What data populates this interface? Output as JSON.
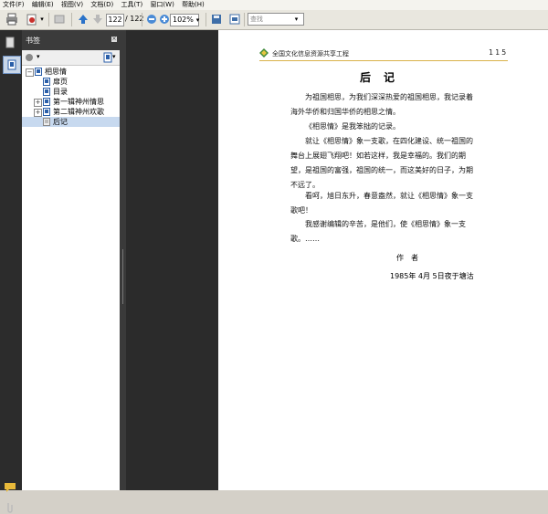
{
  "menu": {
    "items": [
      "文件(F)",
      "编辑(E)",
      "视图(V)",
      "文档(D)",
      "工具(T)",
      "窗口(W)",
      "帮助(H)"
    ]
  },
  "toolbar": {
    "page_current": "122",
    "page_total": "/ 122",
    "zoom": "102%",
    "search_placeholder": "查找"
  },
  "sidebar": {
    "title": "书签",
    "items": [
      {
        "label": "相思情",
        "level": 0,
        "expander": "−"
      },
      {
        "label": "扉页",
        "level": 1
      },
      {
        "label": "目录",
        "level": 1
      },
      {
        "label": "第一辑神州情思",
        "level": 1,
        "expander": "+"
      },
      {
        "label": "第二辑神州欢歌",
        "level": 1,
        "expander": "+"
      },
      {
        "label": "后记",
        "level": 1,
        "selected": true
      }
    ]
  },
  "page": {
    "header_title": "全国文化信息资源共享工程",
    "page_number": "115",
    "title": "后记",
    "paragraphs": [
      "为祖国相思，为我们深深热爱的祖国相思，我记录着海外华侨和归国华侨的相思之情。",
      "《相思情》是我笨拙的记录。",
      "就让《相思情》象一支歌，在四化建设、统一祖国的舞台上展翅飞翔吧！如若这样，我是幸福的。我们的期望，是祖国的富强，祖国的统一，而这美好的日子，为期不远了。",
      "看呵，旭日东升，春意盎然，就让《相思情》象一支歌吧！",
      "我感谢编辑的辛苦，是他们，使《相思情》象一支歌。……"
    ],
    "signature_role": "作者",
    "signature_date": "1985年 4月 5日夜于塘沽"
  },
  "colors": {
    "header_rule": "#d9b24a",
    "selection": "#c7d9ef",
    "dark_panel": "#2b2b2b"
  }
}
